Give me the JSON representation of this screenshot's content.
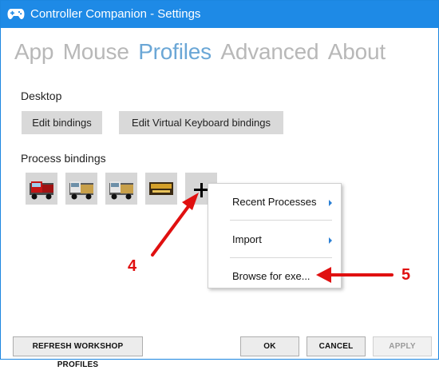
{
  "window": {
    "title": "Controller Companion - Settings"
  },
  "nav": {
    "tabs": [
      {
        "label": "App"
      },
      {
        "label": "Mouse"
      },
      {
        "label": "Profiles",
        "active": true
      },
      {
        "label": "Advanced"
      },
      {
        "label": "About"
      }
    ]
  },
  "desktop": {
    "section_label": "Desktop",
    "edit_bindings_label": "Edit bindings",
    "edit_vk_bindings_label": "Edit Virtual Keyboard bindings"
  },
  "process_bindings": {
    "section_label": "Process bindings",
    "process_icons": [
      "truck-red-icon",
      "truck-icon",
      "truck-icon",
      "game-logo-icon"
    ],
    "add_icon": "plus-icon"
  },
  "context_menu": {
    "items": [
      {
        "label": "Recent Processes",
        "has_submenu": true
      },
      {
        "label": "Import",
        "has_submenu": true
      },
      {
        "label": "Browse for exe...",
        "has_submenu": false
      }
    ]
  },
  "annotations": {
    "marker_4": "4",
    "marker_5": "5",
    "color": "#e01010"
  },
  "footer": {
    "refresh_label": "REFRESH WORKSHOP PROFILES",
    "ok_label": "OK",
    "cancel_label": "CANCEL",
    "apply_label": "APPLY"
  },
  "colors": {
    "titlebar": "#1e8ae6",
    "active_tab": "#6ba7d6",
    "inactive_tab": "#b8b8b8",
    "submenu_arrow": "#2a7fd4"
  }
}
